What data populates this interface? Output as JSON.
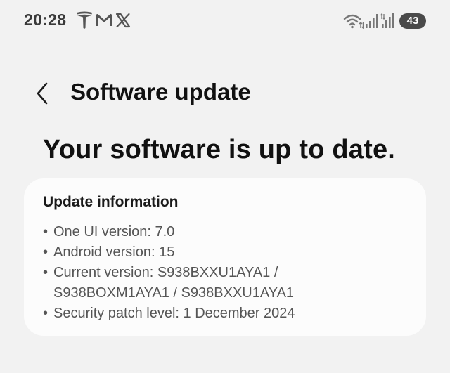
{
  "status_bar": {
    "time": "20:28",
    "notification_icons": [
      "tesla-icon",
      "gmail-icon",
      "x-icon"
    ],
    "system_icons": [
      "wifi-icon",
      "signal-strength-icon",
      "signal-strength-icon"
    ],
    "battery": "43"
  },
  "app_bar": {
    "back_icon": "chevron-left-icon",
    "title": "Software update"
  },
  "main": {
    "headline": "Your software is up to date."
  },
  "update_information": {
    "title": "Update information",
    "bullet": "•",
    "items": [
      {
        "line1": "One UI version: 7.0"
      },
      {
        "line1": "Android version: 15"
      },
      {
        "line1": "Current version: S938BXXU1AYA1 /",
        "line2": "S938BOXM1AYA1 / S938BXXU1AYA1"
      },
      {
        "line1": "Security patch level: 1 December 2024"
      }
    ]
  }
}
